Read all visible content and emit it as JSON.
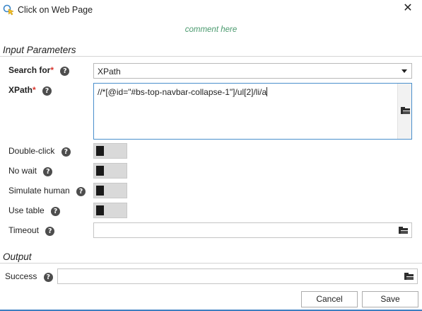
{
  "window": {
    "title": "Click on Web Page",
    "close_icon": "close-icon",
    "app_icon": "click-cursor-icon"
  },
  "comment": "comment here",
  "input_parameters": {
    "heading": "Input Parameters",
    "search_for": {
      "label": "Search for",
      "required_mark": "*",
      "value": "XPath"
    },
    "xpath": {
      "label": "XPath",
      "required_mark": "*",
      "value": "//*[@id=\"#bs-top-navbar-collapse-1\"]/ul[2]/li/a"
    },
    "double_click": {
      "label": "Double-click",
      "on": false
    },
    "no_wait": {
      "label": "No wait",
      "on": false
    },
    "simulate_human": {
      "label": "Simulate human",
      "on": false
    },
    "use_table": {
      "label": "Use table",
      "on": false
    },
    "timeout": {
      "label": "Timeout",
      "value": ""
    }
  },
  "output": {
    "heading": "Output",
    "success": {
      "label": "Success",
      "value": ""
    }
  },
  "help_glyph": "?",
  "buttons": {
    "cancel": "Cancel",
    "save": "Save"
  },
  "colors": {
    "accent": "#3c7fc0",
    "comment": "#4a9a6e",
    "required": "#d9332b"
  }
}
